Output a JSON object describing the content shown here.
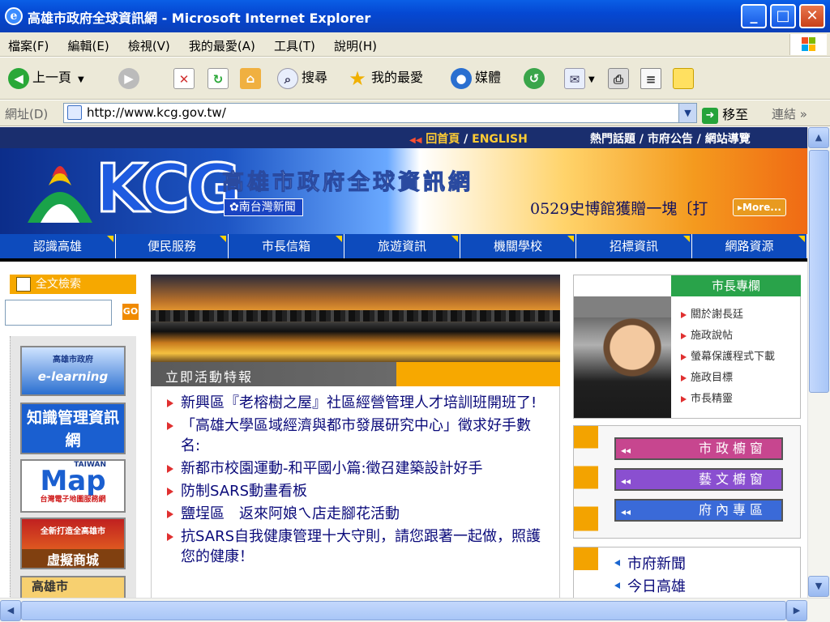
{
  "window": {
    "title": "高雄市政府全球資訊網 - Microsoft Internet Explorer",
    "ie_icon": "e",
    "minimize_glyph": "_",
    "maximize_glyph": "□",
    "close_glyph": "✕"
  },
  "menu": [
    "檔案(F)",
    "編輯(E)",
    "檢視(V)",
    "我的最愛(A)",
    "工具(T)",
    "說明(H)"
  ],
  "toolbar": {
    "back_label": "上一頁",
    "search_label": "搜尋",
    "favorites_label": "我的最愛",
    "media_label": "媒體"
  },
  "address": {
    "label": "網址(D)",
    "url": "http://www.kcg.gov.tw/",
    "go_label": "移至",
    "links_label": "連結"
  },
  "topnav": {
    "home": "回首頁",
    "sep1": " / ",
    "english": "ENGLISH",
    "hot": "熱門話題",
    "notice": "市府公告",
    "sitemap": "網站導覽",
    "sep": " / "
  },
  "banner": {
    "logo_text": "KCG",
    "site_name": "高雄市政府全球資訊網",
    "tag": "南台灣新聞",
    "ticker": "0529史博館獲贈一塊〔打",
    "more": "More..."
  },
  "mainnav": [
    "認識高雄",
    "便民服務",
    "市長信箱",
    "旅遊資訊",
    "機關學校",
    "招標資訊",
    "網路資源"
  ],
  "search": {
    "title": "全文檢索",
    "go": "GO"
  },
  "left_links": {
    "elearning_top": "高雄市政府",
    "elearning": "e-learning",
    "knowledge": "知識管理資訊網",
    "map_brand": "TAIWAN",
    "map": "Map",
    "map_caption": "台灣電子地圖服務網",
    "mall_top": "全新打造全高雄市",
    "mall": "虛擬商城",
    "kaohsiung": "高雄市"
  },
  "activity": {
    "title": "立即活動特報",
    "items": [
      "新興區『老榕樹之屋』社區經營管理人才培訓班開班了!",
      "「高雄大學區域經濟與都市發展研究中心」徵求好手數名:",
      "新都市校園運動-和平國小篇:徵召建築設計好手",
      "防制SARS動畫看板",
      "鹽埕區　返來阿娘ㄟ店走腳花活動",
      "抗SARS自我健康管理十大守則，請您跟著一起做，照護您的健康！"
    ]
  },
  "mayor": {
    "title": "市長專欄",
    "links": [
      "關於謝長廷",
      "施政說帖",
      "螢幕保護程式下載",
      "施政目標",
      "市長精靈"
    ]
  },
  "windows": {
    "gov": "市政櫥窗",
    "art": "藝文櫥窗",
    "internal": "府內專區",
    "arrow": "◂◂"
  },
  "city_news": [
    "市府新聞",
    "今日高雄"
  ],
  "scroll": {
    "up": "▲",
    "down": "▼",
    "left": "◀",
    "right": "▶"
  },
  "colors": {
    "titlebar": "#0548d3",
    "nav_blue": "#0d4bbd",
    "orange": "#f6a800",
    "green_header": "#29a34a",
    "link_navy": "#0a0a7a"
  }
}
